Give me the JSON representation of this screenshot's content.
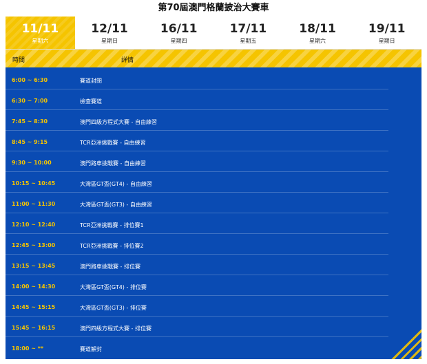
{
  "title": "第70屆澳門格蘭披治大賽車",
  "tabs": [
    {
      "date": "11/11",
      "weekday": "星期六",
      "active": true
    },
    {
      "date": "12/11",
      "weekday": "星期日",
      "active": false
    },
    {
      "date": "16/11",
      "weekday": "星期四",
      "active": false
    },
    {
      "date": "17/11",
      "weekday": "星期五",
      "active": false
    },
    {
      "date": "18/11",
      "weekday": "星期六",
      "active": false
    },
    {
      "date": "19/11",
      "weekday": "星期日",
      "active": false
    }
  ],
  "table": {
    "header": {
      "time": "時間",
      "details": "詳情"
    },
    "rows": [
      {
        "time": "6:00 ~ 6:30",
        "event": "賽道封閉"
      },
      {
        "time": "6:30 ~ 7:00",
        "event": "檢查賽道"
      },
      {
        "time": "7:45 ~ 8:30",
        "event": "澳門四級方程式大賽 - 自由練習"
      },
      {
        "time": "8:45 ~ 9:15",
        "event": "TCR亞洲挑戰賽 - 自由練習"
      },
      {
        "time": "9:30 ~ 10:00",
        "event": "澳門路車挑戰賽 - 自由練習"
      },
      {
        "time": "10:15 ~ 10:45",
        "event": "大灣區GT盃(GT4) - 自由練習"
      },
      {
        "time": "11:00 ~ 11:30",
        "event": "大灣區GT盃(GT3) - 自由練習"
      },
      {
        "time": "12:10 ~ 12:40",
        "event": "TCR亞洲挑戰賽 - 排位賽1"
      },
      {
        "time": "12:45 ~ 13:00",
        "event": "TCR亞洲挑戰賽 - 排位賽2"
      },
      {
        "time": "13:15 ~ 13:45",
        "event": "澳門路車挑戰賽 - 排位賽"
      },
      {
        "time": "14:00 ~ 14:30",
        "event": "大灣區GT盃(GT4) - 排位賽"
      },
      {
        "time": "14:45 ~ 15:15",
        "event": "大灣區GT盃(GT3) - 排位賽"
      },
      {
        "time": "15:45 ~ 16:15",
        "event": "澳門四級方程式大賽 - 排位賽"
      },
      {
        "time": "18:00 ~ **",
        "event": "賽道解封"
      }
    ]
  },
  "colors": {
    "accent": "#f5c400",
    "panel": "#0a4bb3"
  }
}
